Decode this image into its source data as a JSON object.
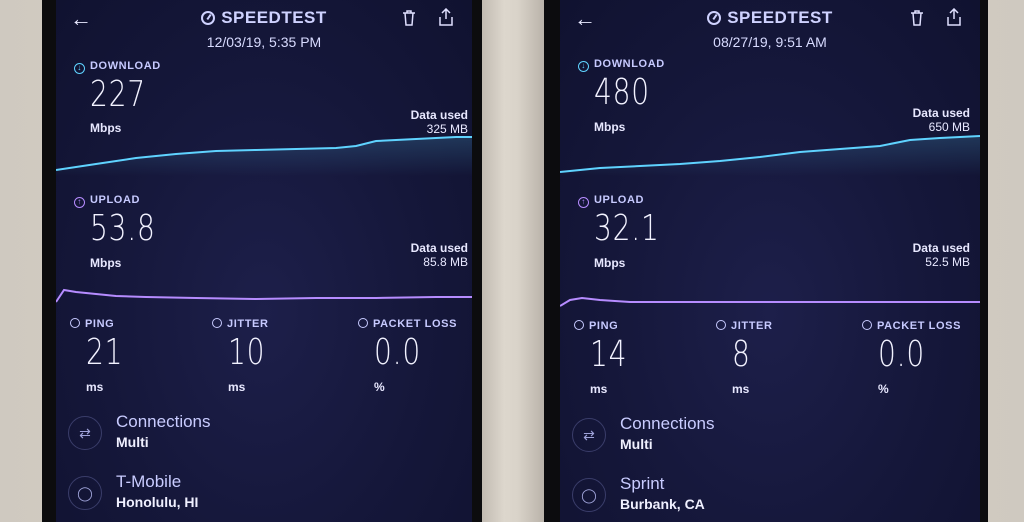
{
  "left": {
    "title": "SPEEDTEST",
    "date": "12/03/19, 5:35 PM",
    "download": {
      "label": "DOWNLOAD",
      "value": "227",
      "unit": "Mbps",
      "data_used_label": "Data used",
      "data_used": "325 MB"
    },
    "upload": {
      "label": "UPLOAD",
      "value": "53.8",
      "unit": "Mbps",
      "data_used_label": "Data used",
      "data_used": "85.8 MB"
    },
    "ping": {
      "label": "PING",
      "value": "21",
      "unit": "ms"
    },
    "jitter": {
      "label": "JITTER",
      "value": "10",
      "unit": "ms"
    },
    "packet_loss": {
      "label": "PACKET LOSS",
      "value": "0.0",
      "unit": "%"
    },
    "connections": {
      "title": "Connections",
      "value": "Multi"
    },
    "provider": {
      "name": "T-Mobile",
      "location": "Honolulu, HI"
    }
  },
  "right": {
    "title": "SPEEDTEST",
    "date": "08/27/19, 9:51 AM",
    "download": {
      "label": "DOWNLOAD",
      "value": "480",
      "unit": "Mbps",
      "data_used_label": "Data used",
      "data_used": "650 MB"
    },
    "upload": {
      "label": "UPLOAD",
      "value": "32.1",
      "unit": "Mbps",
      "data_used_label": "Data used",
      "data_used": "52.5 MB"
    },
    "ping": {
      "label": "PING",
      "value": "14",
      "unit": "ms"
    },
    "jitter": {
      "label": "JITTER",
      "value": "8",
      "unit": "ms"
    },
    "packet_loss": {
      "label": "PACKET LOSS",
      "value": "0.0",
      "unit": "%"
    },
    "connections": {
      "title": "Connections",
      "value": "Multi"
    },
    "provider": {
      "name": "Sprint",
      "location": "Burbank, CA"
    }
  },
  "icons": {
    "back": "arrow-left-icon",
    "delete": "trash-icon",
    "share": "share-icon",
    "connections": "connections-icon",
    "globe": "globe-icon"
  },
  "colors": {
    "screen": "#15173a",
    "download_line": "#5fd3ff",
    "upload_line": "#b68cff",
    "text": "#c7caff"
  }
}
